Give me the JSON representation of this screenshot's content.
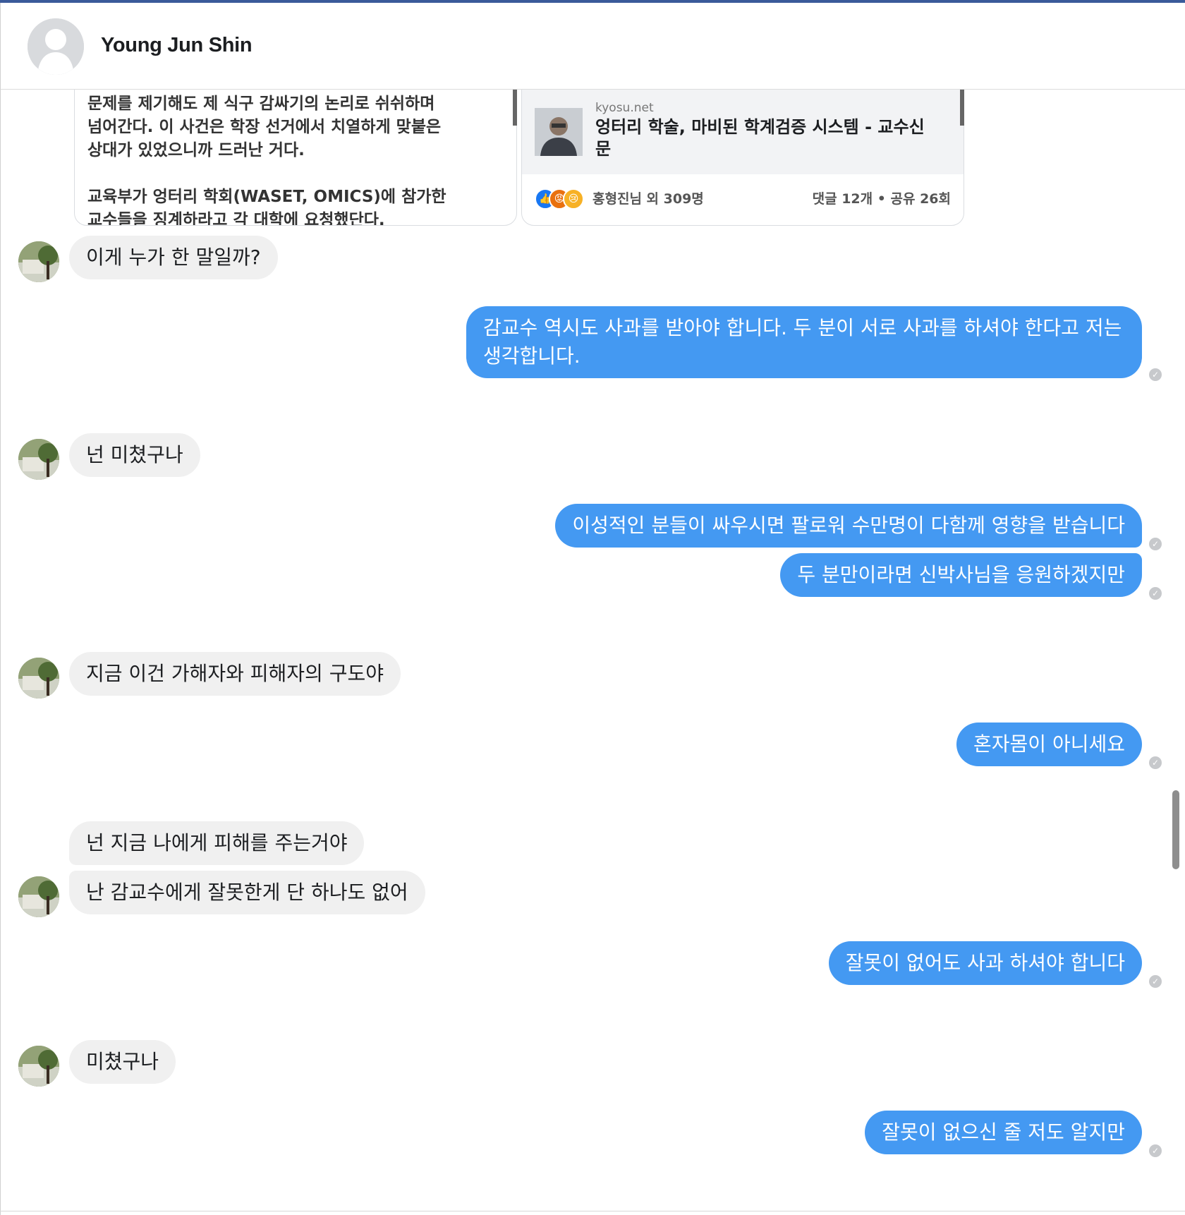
{
  "header": {
    "name": "Young Jun Shin"
  },
  "shared_posts": [
    {
      "text": "문제를 제기해도 제 식구 감싸기의 논리로 쉬쉬하며\n넘어간다. 이 사건은 학장 선거에서 치열하게 맞붙은\n상대가 있었으니까 드러난 거다.\n\n교육부가 엉터리 학회(WASET, OMICS)에 참가한\n교수들을 징계하라고 각 대학에 요청했단다."
    },
    {
      "domain": "kyosu.net",
      "title": "엉터리 학술, 마비된 학계검증 시스템 - 교수신문",
      "reactions": "홍형진님 외 309명",
      "stats": "댓글 12개 • 공유 26회"
    }
  ],
  "messages": [
    {
      "from": "them",
      "text": "이게 누가 한 말일까?"
    },
    {
      "from": "me",
      "text": "감교수 역시도 사과를 받아야 합니다. 두 분이 서로 사과를 하셔야 한다고 저는 생각합니다."
    },
    {
      "from": "them",
      "text": "넌 미쳤구나"
    },
    {
      "from": "me",
      "text": "이성적인 분들이 싸우시면 팔로워 수만명이 다함께 영향을 받습니다"
    },
    {
      "from": "me",
      "text": "두 분만이라면 신박사님을 응원하겠지만"
    },
    {
      "from": "them",
      "text": "지금 이건 가해자와 피해자의 구도야"
    },
    {
      "from": "me",
      "text": "혼자몸이 아니세요"
    },
    {
      "from": "them",
      "text": "넌 지금 나에게 피해를 주는거야"
    },
    {
      "from": "them",
      "text": "난 감교수에게 잘못한게 단 하나도 없어"
    },
    {
      "from": "me",
      "text": "잘못이 없어도 사과 하셔야 합니다"
    },
    {
      "from": "them",
      "text": "미쳤구나"
    },
    {
      "from": "me",
      "text": "잘못이 없으신 줄 저도 알지만"
    }
  ],
  "colors": {
    "outgoing": "#4499f2",
    "incoming": "#f0f0f0",
    "seen": "#c7c9cc"
  },
  "icons": {
    "seen": "check-circle-icon",
    "like": "like-icon",
    "angry": "angry-icon",
    "sad": "sad-icon"
  }
}
